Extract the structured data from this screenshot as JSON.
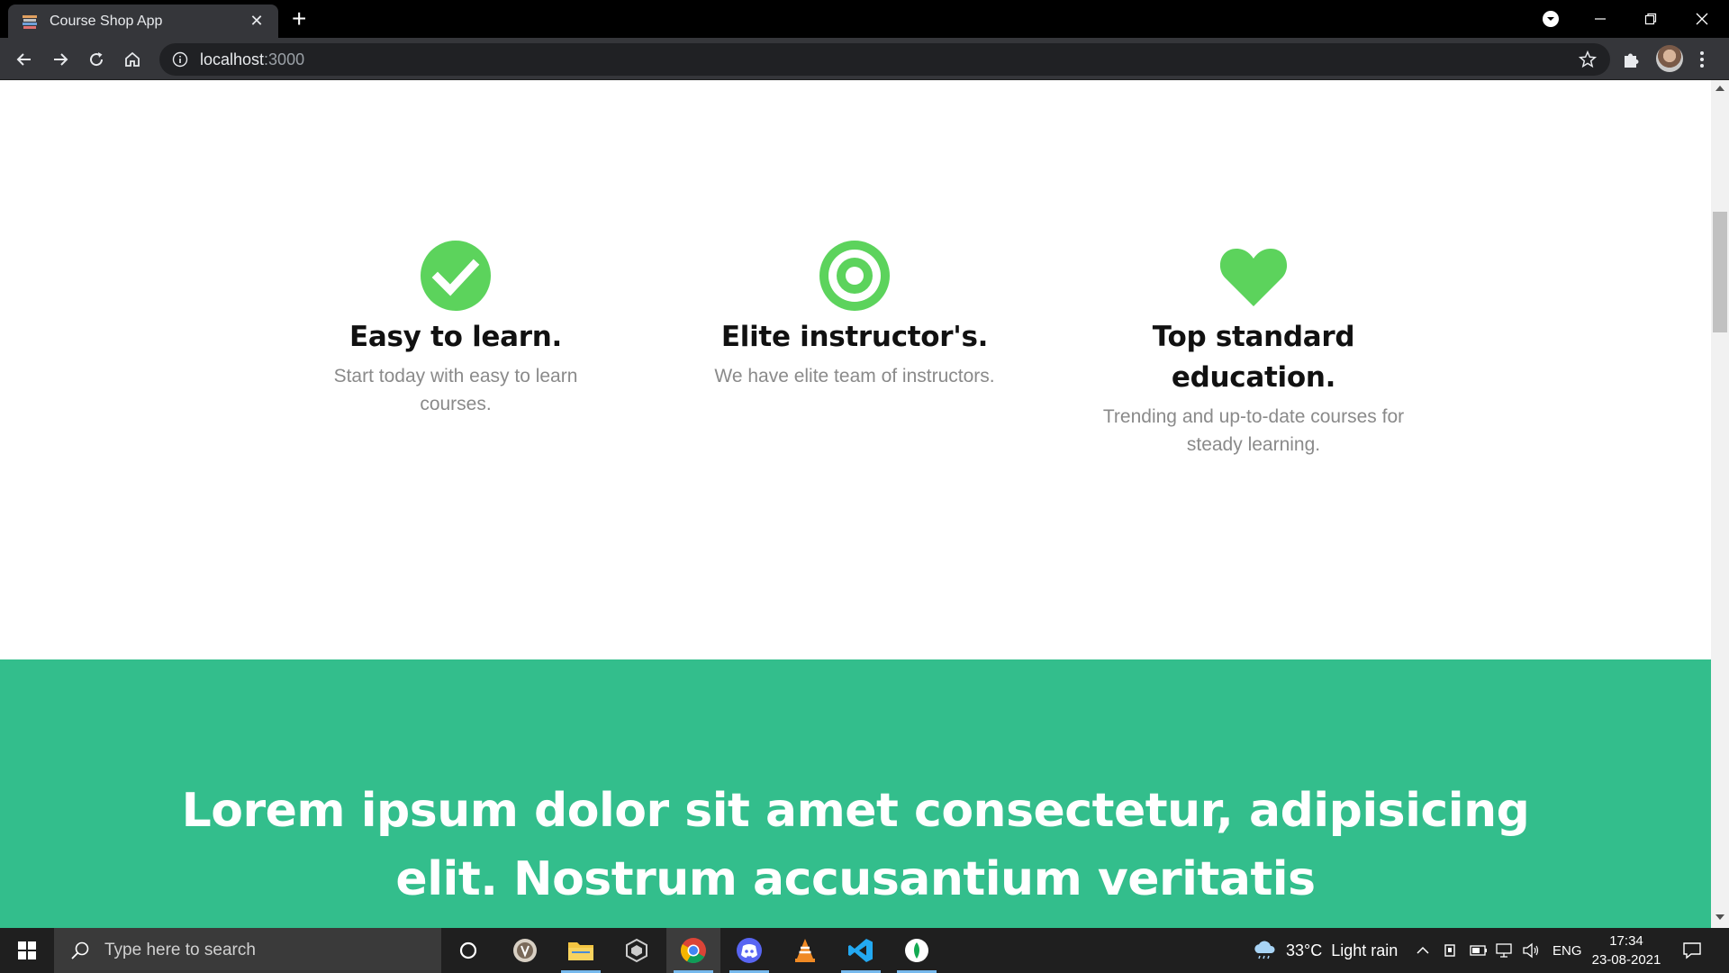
{
  "browser": {
    "tab_title": "Course Shop App",
    "url_host": "localhost",
    "url_port": ":3000"
  },
  "features": [
    {
      "icon": "check-circle-icon",
      "title": "Easy to learn.",
      "text": "Start today with easy to learn courses."
    },
    {
      "icon": "target-icon",
      "title": "Elite instructor's.",
      "text": "We have elite team of instructors."
    },
    {
      "icon": "heart-icon",
      "title": "Top standard education.",
      "text": "Trending and up-to-date courses for steady learning."
    }
  ],
  "hero": {
    "heading": "Lorem ipsum dolor sit amet consectetur, adipisicing elit. Nostrum accusantium veritatis"
  },
  "colors": {
    "accent_green": "#5cd35c",
    "hero_background": "#33be8c"
  },
  "taskbar": {
    "search_placeholder": "Type here to search",
    "weather": "33°C  Light rain",
    "language": "ENG",
    "time": "17:34",
    "date": "23-08-2021"
  }
}
